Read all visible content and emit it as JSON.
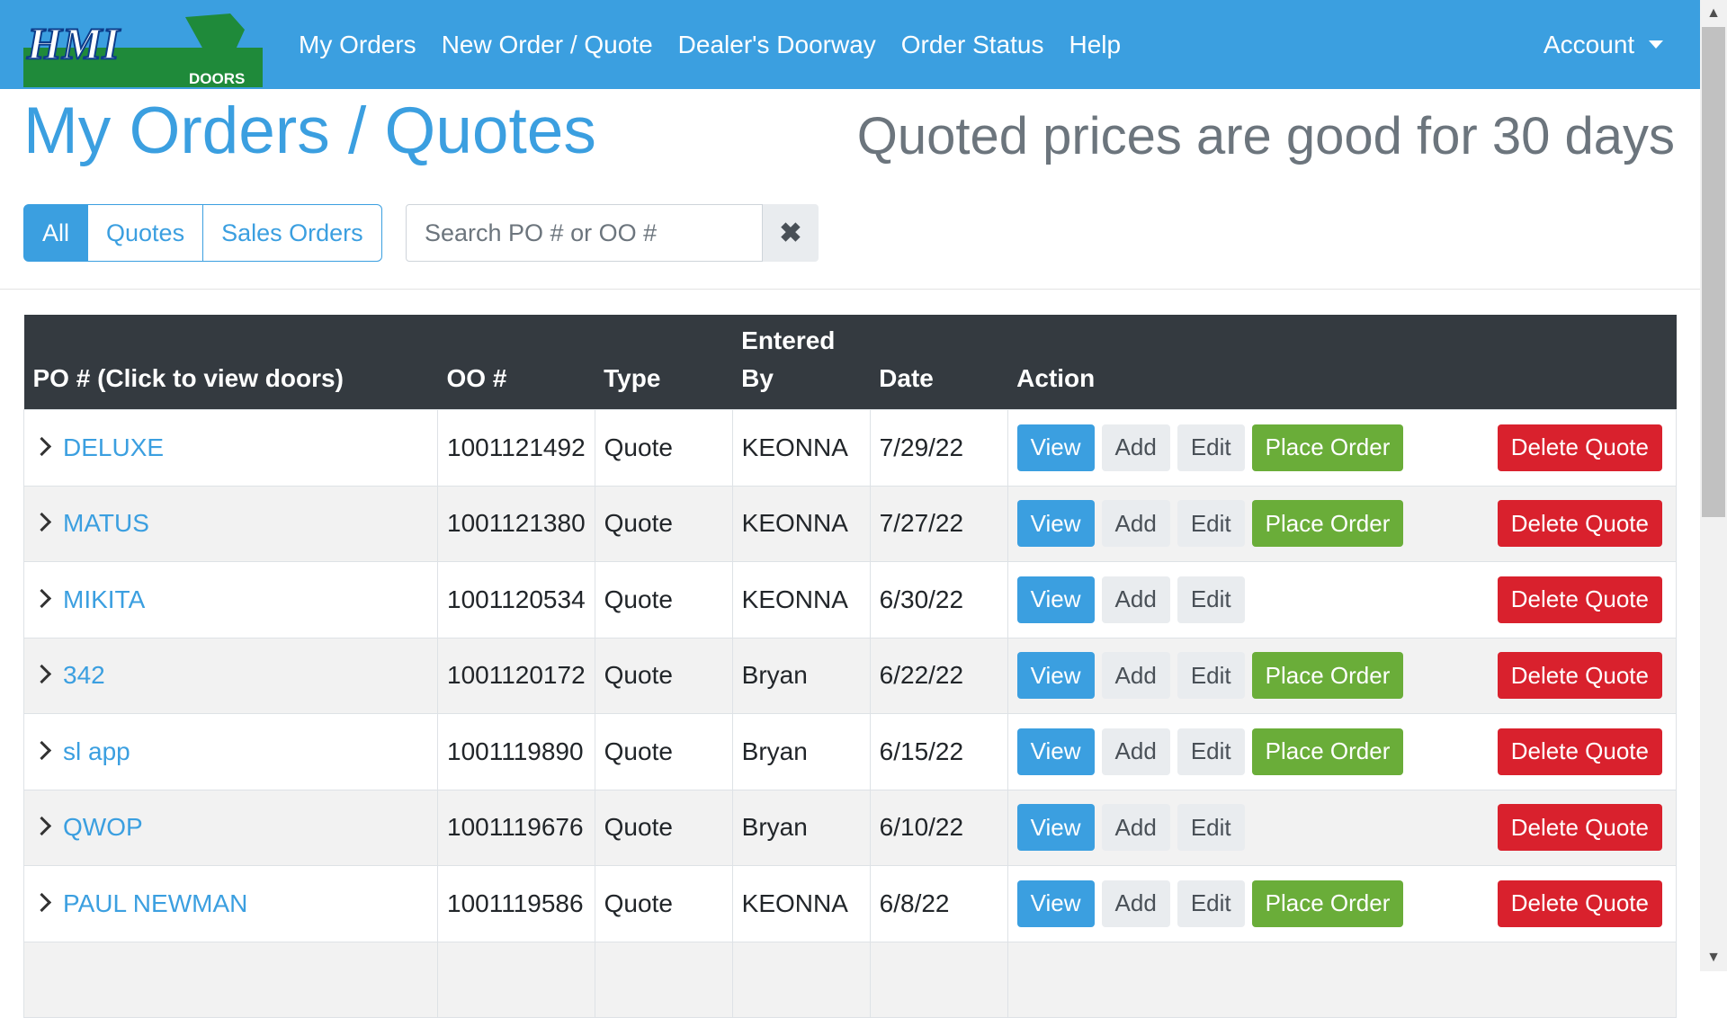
{
  "brand": {
    "logo_text": "HMI",
    "logo_sub": "DOORS"
  },
  "nav": {
    "links": [
      "My Orders",
      "New Order / Quote",
      "Dealer's Doorway",
      "Order Status",
      "Help"
    ],
    "account": "Account"
  },
  "page": {
    "title": "My Orders / Quotes",
    "subtitle": "Quoted prices are good for 30 days"
  },
  "filters": {
    "all": "All",
    "quotes": "Quotes",
    "sales_orders": "Sales Orders",
    "active": "All"
  },
  "search": {
    "placeholder": "Search PO # or OO #",
    "value": "",
    "clear_icon": "✖"
  },
  "table": {
    "headers": {
      "po": "PO # (Click to view doors)",
      "oo": "OO #",
      "type": "Type",
      "entered_by_1": "Entered",
      "entered_by_2": "By",
      "date": "Date",
      "action": "Action"
    },
    "buttons": {
      "view": "View",
      "add": "Add",
      "edit": "Edit",
      "place": "Place Order",
      "delete": "Delete Quote"
    },
    "rows": [
      {
        "po": "DELUXE",
        "oo": "1001121492",
        "type": "Quote",
        "entered_by": "KEONNA",
        "date": "7/29/22",
        "can_place": true
      },
      {
        "po": "MATUS",
        "oo": "1001121380",
        "type": "Quote",
        "entered_by": "KEONNA",
        "date": "7/27/22",
        "can_place": true
      },
      {
        "po": "MIKITA",
        "oo": "1001120534",
        "type": "Quote",
        "entered_by": "KEONNA",
        "date": "6/30/22",
        "can_place": false
      },
      {
        "po": "342",
        "oo": "1001120172",
        "type": "Quote",
        "entered_by": "Bryan",
        "date": "6/22/22",
        "can_place": true
      },
      {
        "po": "sl app",
        "oo": "1001119890",
        "type": "Quote",
        "entered_by": "Bryan",
        "date": "6/15/22",
        "can_place": true
      },
      {
        "po": "QWOP",
        "oo": "1001119676",
        "type": "Quote",
        "entered_by": "Bryan",
        "date": "6/10/22",
        "can_place": false
      },
      {
        "po": "PAUL NEWMAN",
        "oo": "1001119586",
        "type": "Quote",
        "entered_by": "KEONNA",
        "date": "6/8/22",
        "can_place": true
      }
    ]
  },
  "colors": {
    "primary": "#3b9fe0",
    "success": "#6aad39",
    "danger": "#d9212d",
    "header_dark": "#343a40"
  }
}
